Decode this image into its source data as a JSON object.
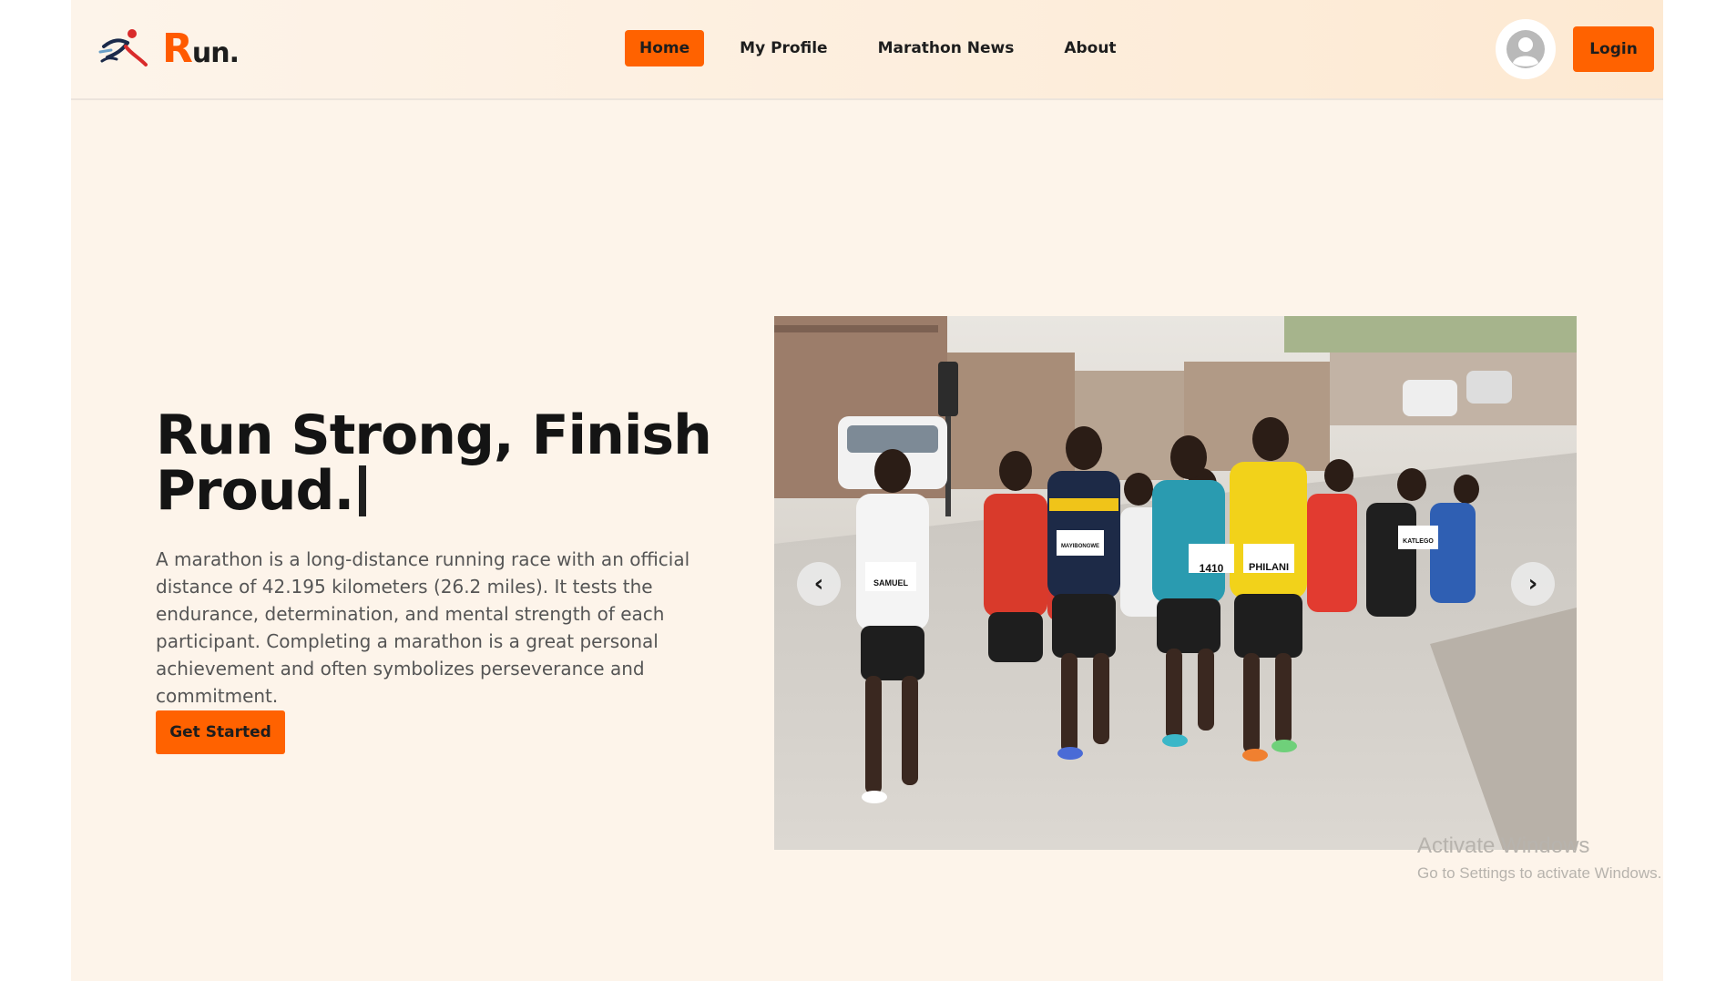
{
  "brand": {
    "letter": "R",
    "rest": "un."
  },
  "nav": {
    "items": [
      {
        "label": "Home",
        "active": true
      },
      {
        "label": "My Profile",
        "active": false
      },
      {
        "label": "Marathon News",
        "active": false
      },
      {
        "label": "About",
        "active": false
      }
    ],
    "login_label": "Login"
  },
  "hero": {
    "title_line1": "Run Strong, Finish",
    "title_line2": "Proud.",
    "description": "A marathon is a long-distance running race with an official distance of 42.195 kilometers (26.2 miles). It tests the endurance, determination, and mental strength of each participant. Completing a marathon is a great personal achievement and often symbolizes perseverance and commitment.",
    "cta_label": "Get Started"
  },
  "carousel": {
    "prev_icon": "‹",
    "next_icon": "›",
    "bibs": [
      "SAMUEL",
      "1410",
      "PHILANI",
      "KATLEGO",
      "MAYIBONGWE"
    ]
  },
  "watermark": {
    "line1": "Activate Windows",
    "line2": "Go to Settings to activate Windows."
  },
  "colors": {
    "accent": "#ff6200",
    "background": "#fdf4ea",
    "text": "#141414"
  },
  "icons": {
    "logo": "runner-logo-icon",
    "avatar": "user-avatar-icon",
    "prev": "chevron-left-icon",
    "next": "chevron-right-icon"
  }
}
